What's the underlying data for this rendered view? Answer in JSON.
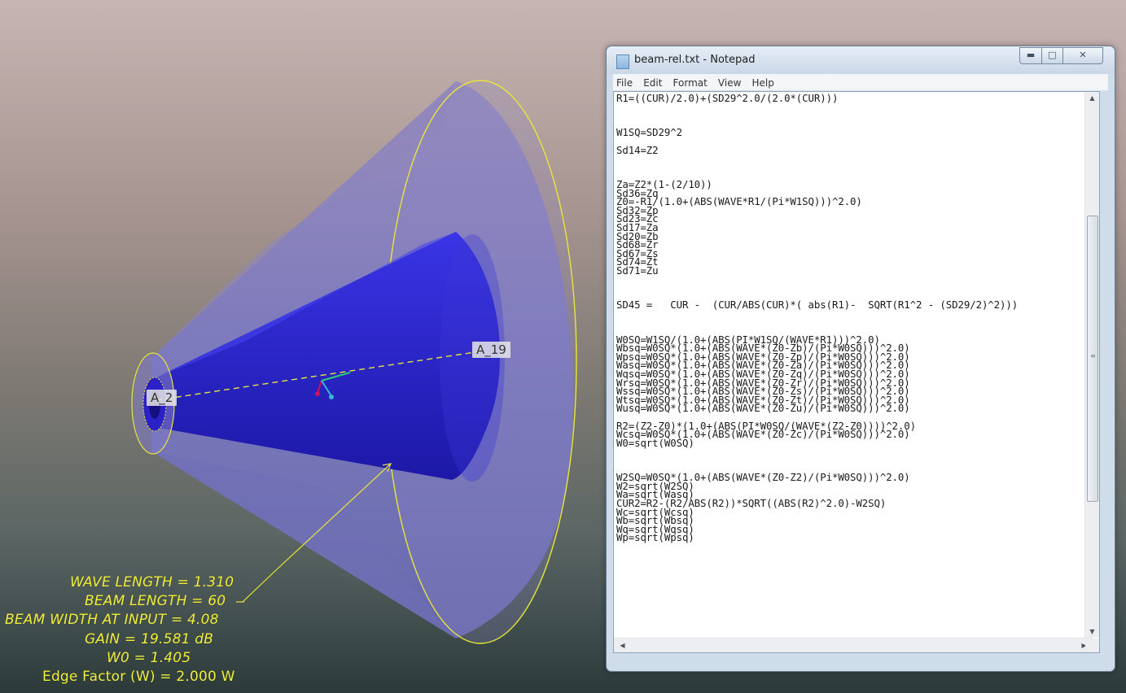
{
  "scene": {
    "anchor_start": "A_2",
    "anchor_end": "A_19",
    "annotations": {
      "wave_length": "WAVE LENGTH = 1.310",
      "beam_length": "BEAM LENGTH = 60",
      "beam_width": "BEAM WIDTH AT INPUT = 4.08",
      "gain": "GAIN = 19.581 dB",
      "w0": "W0 = 1.405",
      "edge_factor": "Edge Factor (W) = 2.000 W"
    },
    "colors": {
      "annotation": "#f2ee3a",
      "inner_cone": "#2f2bd6",
      "outer_cone": "#7e7ec8"
    }
  },
  "notepad": {
    "title": "beam-rel.txt - Notepad",
    "menu": [
      "File",
      "Edit",
      "Format",
      "View",
      "Help"
    ],
    "caption_buttons": {
      "minimize": "minimize-icon",
      "maximize": "maximize-icon",
      "close": "close-icon"
    },
    "lines": [
      "R1=((CUR)/2.0)+(SD29^2.0/(2.0*(CUR)))",
      "",
      "",
      "",
      "W1SQ=SD29^2",
      "",
      "Sd14=Z2",
      "",
      "",
      "",
      "Za=Z2*(1-(2/10))",
      "Sd36=Zq",
      "Z0=-R1/(1.0+(ABS(WAVE*R1/(Pi*W1SQ)))^2.0)",
      "Sd32=Zp",
      "Sd23=Zc",
      "Sd17=Za",
      "Sd20=Zb",
      "Sd68=Zr",
      "Sd67=Zs",
      "Sd74=Zt",
      "Sd71=Zu",
      "",
      "",
      "",
      "SD45 =   CUR -  (CUR/ABS(CUR)*( abs(R1)-  SQRT(R1^2 - (SD29/2)^2)))",
      "",
      "",
      "",
      "W0SQ=W1SQ/(1.0+(ABS(PI*W1SQ/(WAVE*R1)))^2.0)",
      "Wbsq=W0SQ*(1.0+(ABS(WAVE*(Z0-Zb)/(Pi*W0SQ)))^2.0)",
      "Wpsq=W0SQ*(1.0+(ABS(WAVE*(Z0-Zp)/(Pi*W0SQ)))^2.0)",
      "Wasq=W0SQ*(1.0+(ABS(WAVE*(Z0-Za)/(Pi*W0SQ)))^2.0)",
      "Wqsq=W0SQ*(1.0+(ABS(WAVE*(Z0-Zq)/(Pi*W0SQ)))^2.0)",
      "Wrsq=W0SQ*(1.0+(ABS(WAVE*(Z0-Zr)/(Pi*W0SQ)))^2.0)",
      "Wssq=W0SQ*(1.0+(ABS(WAVE*(Z0-Zs)/(Pi*W0SQ)))^2.0)",
      "Wtsq=W0SQ*(1.0+(ABS(WAVE*(Z0-Zt)/(Pi*W0SQ)))^2.0)",
      "Wusq=W0SQ*(1.0+(ABS(WAVE*(Z0-Zu)/(Pi*W0SQ)))^2.0)",
      "",
      "R2=(Z2-Z0)*(1.0+(ABS(PI*W0SQ/(WAVE*(Z2-Z0))))^2.0)",
      "Wcsq=W0SQ*(1.0+(ABS(WAVE*(Z0-Zc)/(Pi*W0SQ)))^2.0)",
      "W0=sqrt(W0SQ)",
      "",
      "",
      "",
      "W2SQ=W0SQ*(1.0+(ABS(WAVE*(Z0-Z2)/(Pi*W0SQ)))^2.0)",
      "W2=sqrt(W2SQ)",
      "Wa=sqrt(Wasq)",
      "CUR2=R2-(R2/ABS(R2))*SQRT((ABS(R2)^2.0)-W2SQ)",
      "Wc=sqrt(Wcsq)",
      "Wb=sqrt(Wbsq)",
      "Wq=sqrt(Wqsq)",
      "Wp=sqrt(Wpsq)"
    ]
  }
}
